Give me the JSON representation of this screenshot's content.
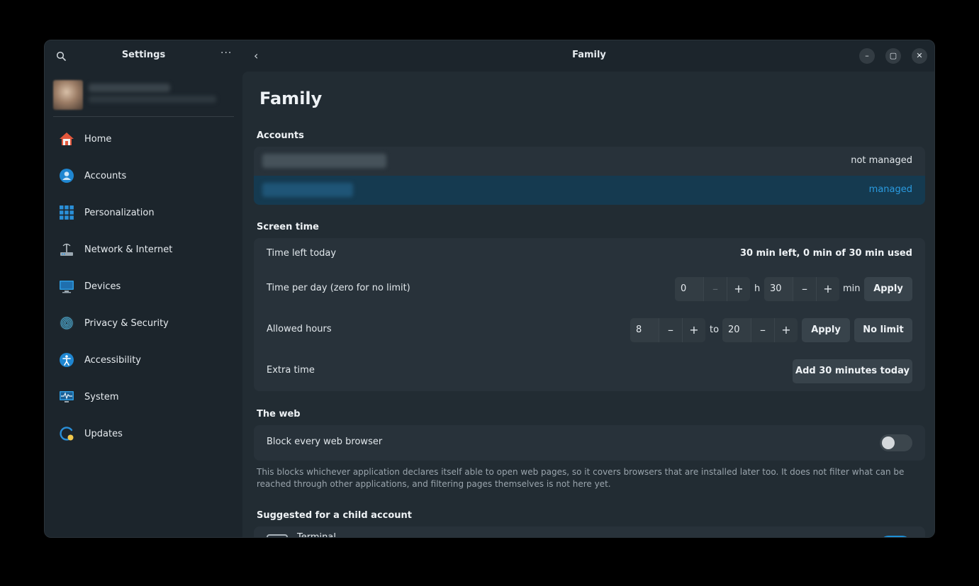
{
  "sidebar": {
    "title": "Settings",
    "more_glyph": "···",
    "items": [
      {
        "label": "Home",
        "icon": "home-icon"
      },
      {
        "label": "Accounts",
        "icon": "accounts-icon"
      },
      {
        "label": "Personalization",
        "icon": "personalization-icon"
      },
      {
        "label": "Network & Internet",
        "icon": "network-icon"
      },
      {
        "label": "Devices",
        "icon": "devices-icon"
      },
      {
        "label": "Privacy & Security",
        "icon": "fingerprint-icon"
      },
      {
        "label": "Accessibility",
        "icon": "accessibility-icon"
      },
      {
        "label": "System",
        "icon": "system-icon"
      },
      {
        "label": "Updates",
        "icon": "updates-icon"
      }
    ]
  },
  "header": {
    "title": "Family",
    "back_glyph": "‹",
    "minimize_glyph": "–",
    "maximize_glyph": "▢",
    "close_glyph": "✕"
  },
  "page": {
    "title": "Family",
    "accounts": {
      "heading": "Accounts",
      "rows": [
        {
          "status": "not managed"
        },
        {
          "status": "managed"
        }
      ]
    },
    "screen_time": {
      "heading": "Screen time",
      "time_left_label": "Time left today",
      "time_left_value": "30 min left, 0 min of 30 min used",
      "per_day_label": "Time per day (zero for no limit)",
      "hours_value": "0",
      "hours_unit": "h",
      "minutes_value": "30",
      "minutes_unit": "min",
      "apply_label": "Apply",
      "allowed_label": "Allowed hours",
      "from_value": "8",
      "to_label": "to",
      "to_value": "20",
      "no_limit_label": "No limit",
      "extra_label": "Extra time",
      "add_label": "Add 30 minutes today",
      "minus_glyph": "–",
      "plus_glyph": "+"
    },
    "web": {
      "heading": "The web",
      "block_label": "Block every web browser",
      "block_enabled": false,
      "help": "This blocks whichever application declares itself able to open web pages, so it covers browsers that are installed later too. It does not filter what can be reached through other applications, and filtering pages themselves is not here yet."
    },
    "suggested": {
      "heading": "Suggested for a child account",
      "first_item": "Terminal"
    }
  },
  "colors": {
    "accent": "#1d8fd6",
    "managed_row": "#153a50",
    "window_bg": "#1c252c",
    "content_bg": "#222c33",
    "card_bg": "#28323a"
  }
}
